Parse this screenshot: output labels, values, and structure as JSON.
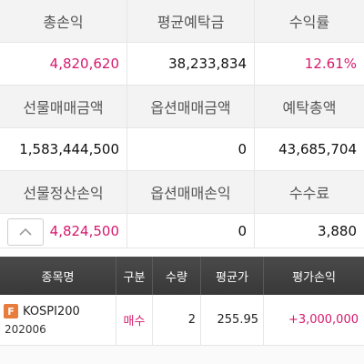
{
  "summary": {
    "row1_headers": [
      "총손익",
      "평균예탁금",
      "수익률"
    ],
    "row1_values": [
      "4,820,620",
      "38,233,834",
      "12.61%"
    ],
    "row2_headers": [
      "선물매매금액",
      "옵션매매금액",
      "예탁총액"
    ],
    "row2_values": [
      "1,583,444,500",
      "0",
      "43,685,704"
    ],
    "row3_headers": [
      "선물정산손익",
      "옵션매매손익",
      "수수료"
    ],
    "row3_values": [
      "4,824,500",
      "0",
      "3,880"
    ]
  },
  "accent_color": "#d6196d",
  "scroll_up_icon": "chevron-up-icon",
  "table": {
    "headers": [
      "종목명",
      "구분",
      "수량",
      "평균가",
      "평가손익"
    ],
    "rows": [
      {
        "badge": "F",
        "name": "KOSPI200",
        "code": "202006",
        "side": "매수",
        "qty": "2",
        "avg": "255.95",
        "pl": "+3,000,000"
      }
    ]
  }
}
